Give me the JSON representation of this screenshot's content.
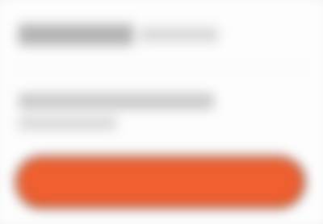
{
  "screen": {
    "background": "#f1f1f1",
    "card_background": "#fdfdfd"
  },
  "header": {
    "title": "",
    "subtitle": ""
  },
  "body": {
    "line_1": "",
    "line_2": ""
  },
  "cta": {
    "label": "",
    "color": "#ef5f2f"
  }
}
